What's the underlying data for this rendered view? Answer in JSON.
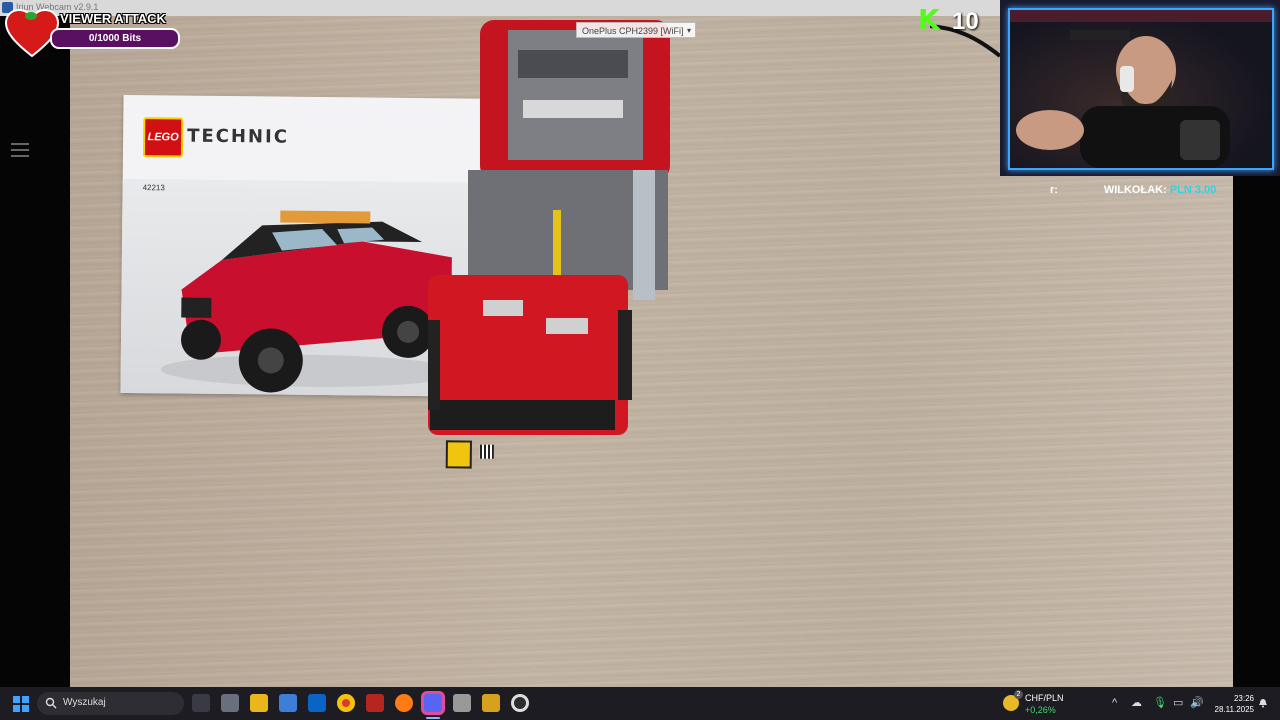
{
  "window": {
    "title": "Iriun Webcam v2.9.1"
  },
  "overlays": {
    "viewer_attack": {
      "title": "VIEWER ATTACK",
      "bits": "0/1000 Bits"
    },
    "kick": {
      "count": "10"
    },
    "ticker": {
      "left_fragment": "r:",
      "name": "WILKOŁAK:",
      "value": "PLN 3.00"
    }
  },
  "camera": {
    "device": "OnePlus CPH2399 [WiFi]"
  },
  "manual": {
    "brand": "LEGO",
    "line": "TECHNIC",
    "set_number": "42213"
  },
  "taskbar": {
    "search_placeholder": "Wyszukaj",
    "apps": [
      "task-view",
      "remote-desktop",
      "file-explorer",
      "store",
      "outlook",
      "chrome",
      "app-red",
      "firefox",
      "discord",
      "media-app",
      "bitcoin-app",
      "obs"
    ],
    "widget": {
      "pair": "CHF/PLN",
      "change": "+0,26%",
      "badge": "2"
    },
    "clock": {
      "time": "23:26",
      "date": "28.11.2025"
    }
  },
  "colors": {
    "accent_purple": "#5a1060",
    "kick_green": "#53fc18",
    "webcam_border": "#3aa7ff",
    "taskbar_bg": "#1c1c22"
  }
}
